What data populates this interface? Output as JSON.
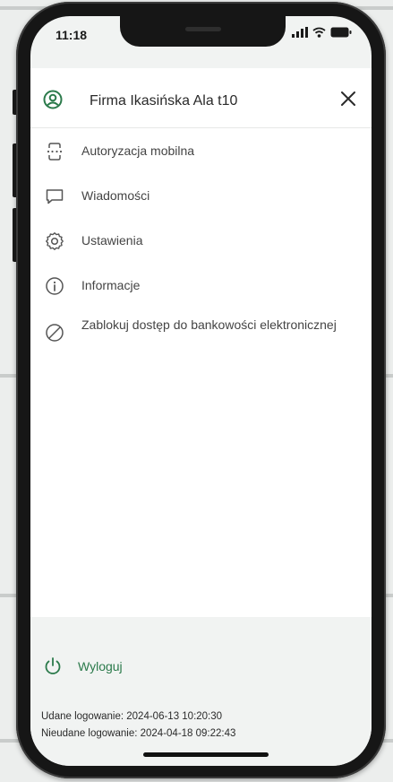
{
  "status_bar": {
    "time": "11:18",
    "icons": [
      "signal-icon",
      "wifi-icon",
      "battery-icon"
    ]
  },
  "header": {
    "title": "Firma Ikasińska Ala t10",
    "icons": [
      "user-circle-icon",
      "close-icon"
    ]
  },
  "menu": {
    "items": [
      {
        "label": "Autoryzacja mobilna",
        "icon": "mobile-authorization-icon"
      },
      {
        "label": "Wiadomości",
        "icon": "message-icon"
      },
      {
        "label": "Ustawienia",
        "icon": "gear-icon"
      },
      {
        "label": "Informacje",
        "icon": "info-icon"
      },
      {
        "label": "Zablokuj dostęp do bankowości elektronicznej",
        "icon": "block-icon"
      }
    ]
  },
  "footer": {
    "logout_label": "Wyloguj",
    "logout_icon": "power-icon",
    "successful_login": "Udane logowanie: 2024-06-13 10:20:30",
    "failed_login": "Nieudane logowanie: 2024-04-18 09:22:43"
  },
  "colors": {
    "accent": "#2b7a4b",
    "text": "#2a2a2a",
    "background": "#f1f3f2",
    "panel": "#ffffff"
  }
}
